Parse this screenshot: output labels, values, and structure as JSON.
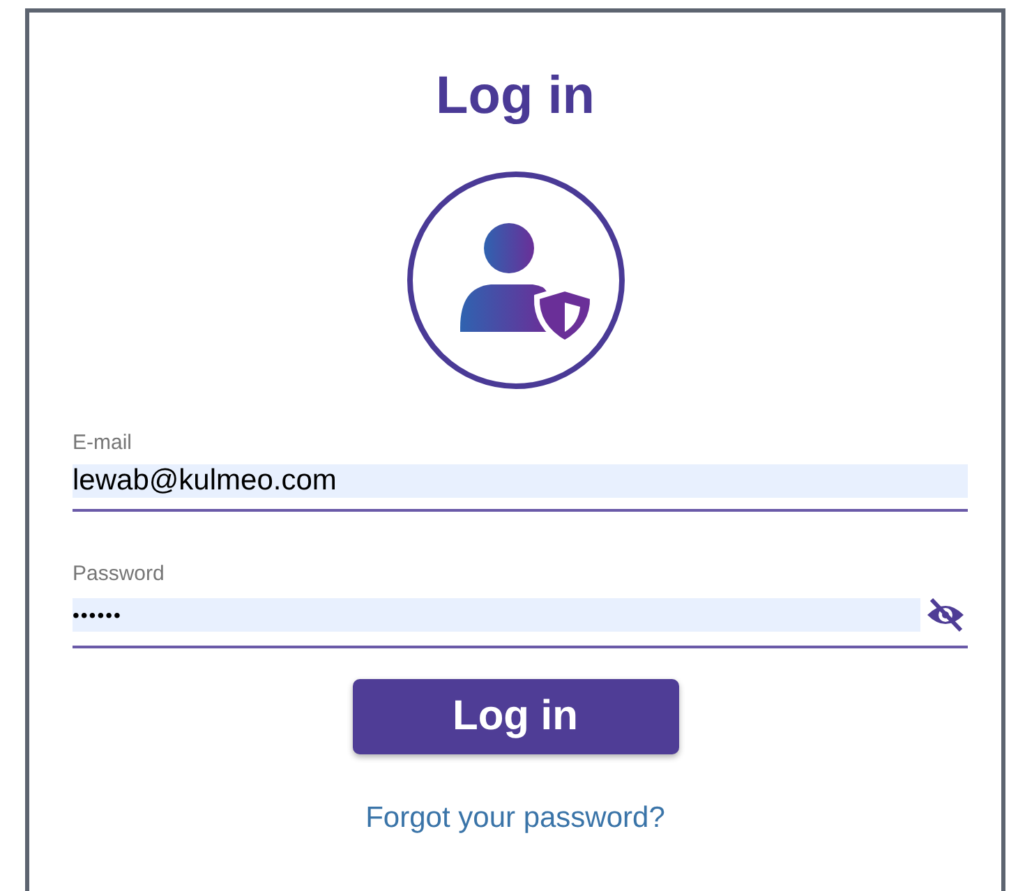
{
  "title": "Log in",
  "email": {
    "label": "E-mail",
    "value": "lewab@kulmeo.com"
  },
  "password": {
    "label": "Password",
    "value": "••••••",
    "visible": false
  },
  "button": "Log in",
  "link": "Forgot your password?"
}
